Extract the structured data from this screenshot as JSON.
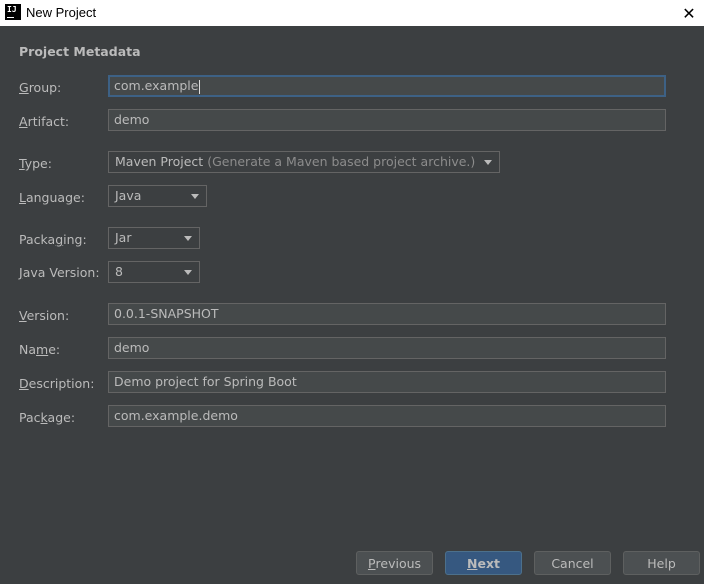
{
  "window": {
    "title": "New Project",
    "app_icon_text": "IJ"
  },
  "section_title": "Project Metadata",
  "fields": {
    "group": {
      "label_mn": "G",
      "label_rest": "roup:",
      "value": "com.example"
    },
    "artifact": {
      "label_mn": "A",
      "label_rest": "rtifact:",
      "value": "demo"
    },
    "type": {
      "label_mn": "T",
      "label_rest": "ype:",
      "value": "Maven Project",
      "hint": "(Generate a Maven based project archive.)"
    },
    "language": {
      "label_mn": "L",
      "label_rest": "anguage:",
      "value": "Java"
    },
    "packaging": {
      "label_pre": "Packa",
      "label_mn": "g",
      "label_rest": "ing:",
      "value": "Jar"
    },
    "java_version": {
      "label_mn": "J",
      "label_rest": "ava Version:",
      "value": "8"
    },
    "version": {
      "label_mn": "V",
      "label_rest": "ersion:",
      "value": "0.0.1-SNAPSHOT"
    },
    "name": {
      "label_pre": "Na",
      "label_mn": "m",
      "label_rest": "e:",
      "value": "demo"
    },
    "description": {
      "label_mn": "D",
      "label_rest": "escription:",
      "value": "Demo project for Spring Boot"
    },
    "package": {
      "label_pre": "Pac",
      "label_mn": "k",
      "label_rest": "age:",
      "value": "com.example.demo"
    }
  },
  "buttons": {
    "previous": {
      "mn": "P",
      "rest": "revious"
    },
    "next": {
      "mn": "N",
      "rest": "ext"
    },
    "cancel": {
      "label": "Cancel"
    },
    "help": {
      "label": "Help"
    }
  },
  "icons": {
    "close": "close-icon"
  }
}
